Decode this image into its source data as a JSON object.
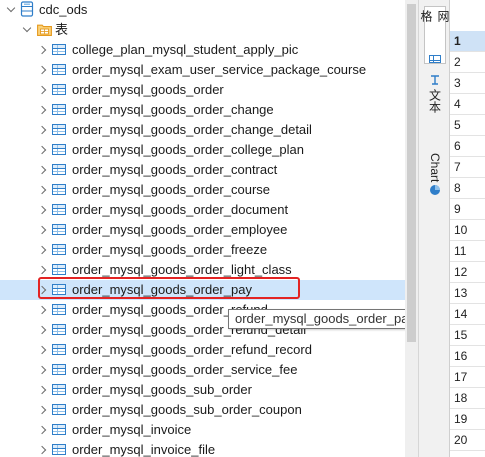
{
  "tree": {
    "database": {
      "name": "cdc_ods",
      "icon": "database-icon"
    },
    "folder": {
      "name": "表",
      "icon": "folder-table-icon"
    },
    "tables": [
      "college_plan_mysql_student_apply_pic",
      "order_mysql_exam_user_service_package_course",
      "order_mysql_goods_order",
      "order_mysql_goods_order_change",
      "order_mysql_goods_order_change_detail",
      "order_mysql_goods_order_college_plan",
      "order_mysql_goods_order_contract",
      "order_mysql_goods_order_course",
      "order_mysql_goods_order_document",
      "order_mysql_goods_order_employee",
      "order_mysql_goods_order_freeze",
      "order_mysql_goods_order_light_class",
      "order_mysql_goods_order_pay",
      "order_mysql_goods_order_refund",
      "order_mysql_goods_order_refund_detail",
      "order_mysql_goods_order_refund_record",
      "order_mysql_goods_order_service_fee",
      "order_mysql_goods_sub_order",
      "order_mysql_goods_sub_order_coupon",
      "order_mysql_invoice",
      "order_mysql_invoice_file"
    ],
    "selected_index": 12,
    "tooltip": "order_mysql_goods_order_pay"
  },
  "side_tabs": [
    {
      "label": "网格",
      "icon": "grid-icon",
      "active": true
    },
    {
      "label": "文本",
      "icon": "text-icon",
      "active": false
    },
    {
      "label": "Chart",
      "icon": "pie-chart-icon",
      "active": false
    }
  ],
  "line_numbers": [
    "1",
    "2",
    "3",
    "4",
    "5",
    "6",
    "7",
    "8",
    "9",
    "10",
    "11",
    "12",
    "13",
    "14",
    "15",
    "16",
    "17",
    "18",
    "19",
    "20"
  ],
  "current_line": "1",
  "colors": {
    "selection": "#cfe5fb",
    "highlight_box": "#e32424",
    "table_icon": "#2f7ec9",
    "folder_icon": "#e59a1f"
  }
}
